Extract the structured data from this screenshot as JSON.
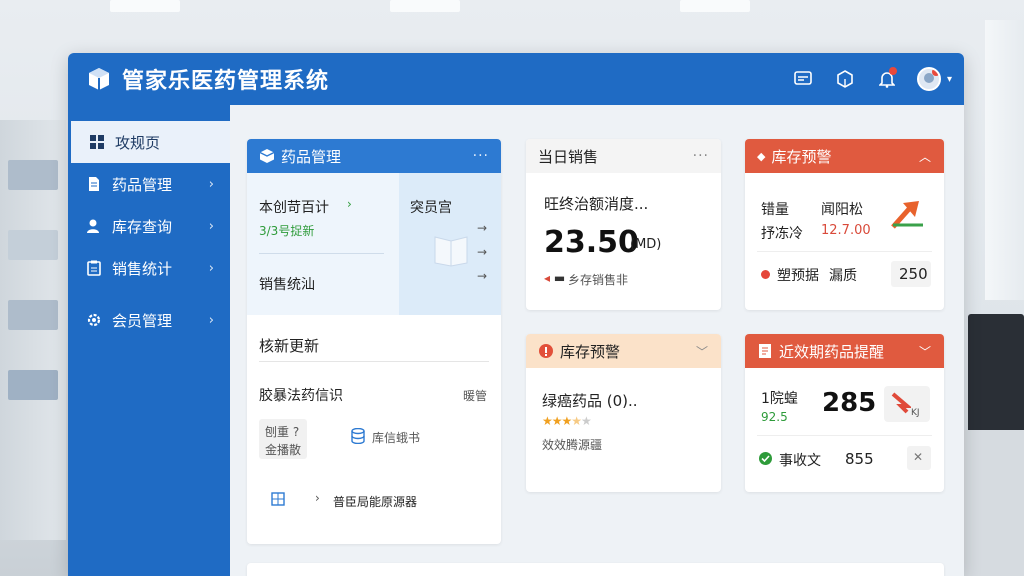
{
  "app": {
    "title": "管家乐医药管理系统"
  },
  "sidebar": {
    "items": [
      {
        "label": "攻规页"
      },
      {
        "label": "药品管理"
      },
      {
        "label": "库存查询"
      },
      {
        "label": "销售统计"
      },
      {
        "label": "会员管理"
      }
    ]
  },
  "cards": {
    "drug_mgmt": {
      "title": "药品管理",
      "more": "···",
      "row1_label": "本创苛百计",
      "row1_sub": "3/3号捉新",
      "row2_label": "销售统汕",
      "side_label": "突员宫",
      "lower_title": "核新更新",
      "lower_row": "胶暴法药信识",
      "lower_row_right": "暖管",
      "tag_line1": "刨重 ?",
      "tag_line2": "金播散",
      "db_label": "库信蛾书",
      "bottom_link": "普臣局能原源器"
    },
    "daily_sales": {
      "title": "当日销售",
      "more": "···",
      "desc": "旺终治额消度...",
      "amount": "23.50",
      "unit": "(MD)",
      "foot": "乡存销售非"
    },
    "stock_warning_top": {
      "title": "库存预警",
      "row1_left": "错量",
      "row1_right": "闻阳松",
      "row2_left": "抒冻冷",
      "row2_right": "12.7.00",
      "row3_label": "塑预据",
      "row3_mid": "漏质",
      "row3_value": "250"
    },
    "stock_warning_mid": {
      "title": "库存预警",
      "line1": "绿癌药品 (0)..",
      "rating": 3.5,
      "line3": "效效腾源疆"
    },
    "expiry": {
      "title": "近效期药品提醒",
      "line1": "1院蝗",
      "line1_sub": "92.5",
      "value1": "285",
      "icon_tag": "KJ",
      "line2": "事收文",
      "value2": "855"
    }
  },
  "colors": {
    "primary": "#1f6bc4",
    "card_blue": "#2d7ad2",
    "card_red": "#e05a3f",
    "card_peach": "#fbe2c9"
  }
}
